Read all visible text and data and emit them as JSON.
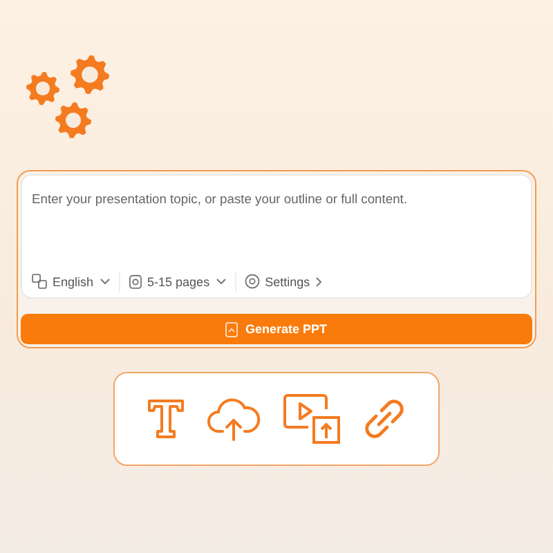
{
  "prompt": {
    "placeholder": "Enter your presentation topic, or paste your outline or full content."
  },
  "options": [
    {
      "kind": "language",
      "label": "English"
    },
    {
      "kind": "pages",
      "label": "5-15 pages"
    },
    {
      "kind": "settings",
      "label": "Settings"
    }
  ],
  "generate_button": {
    "label": "Generate PPT"
  },
  "input_types": [
    {
      "kind": "text"
    },
    {
      "kind": "upload"
    },
    {
      "kind": "video"
    },
    {
      "kind": "link"
    }
  ]
}
